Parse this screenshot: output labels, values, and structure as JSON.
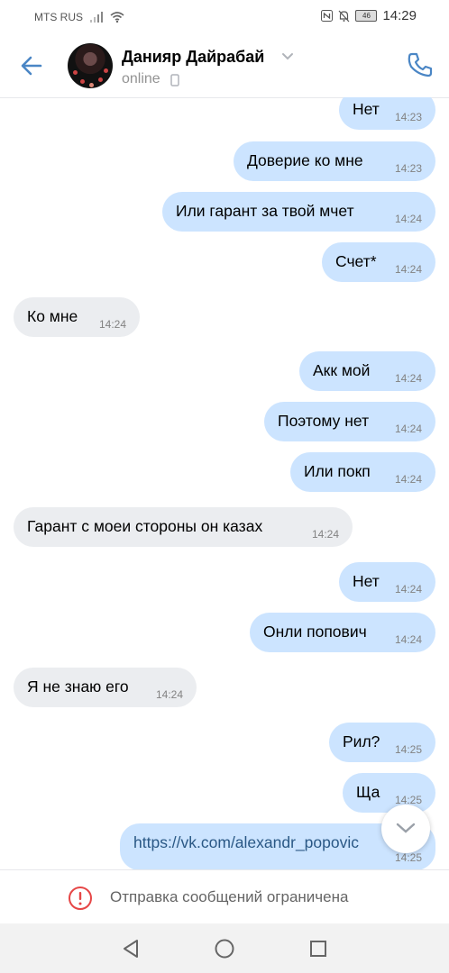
{
  "status_bar": {
    "carrier": "MTS RUS",
    "battery": "46",
    "time": "14:29"
  },
  "header": {
    "contact_name": "Данияр Дайрабай",
    "presence": "online",
    "icons": [
      "back-arrow-icon",
      "chevron-down-icon",
      "mobile-device-icon",
      "phone-icon"
    ]
  },
  "messages": [
    {
      "dir": "out",
      "text": "Нет",
      "time": "14:23"
    },
    {
      "dir": "out",
      "text": "Доверие ко мне",
      "time": "14:23"
    },
    {
      "dir": "out",
      "text": "Или гарант за твой мчет",
      "time": "14:24"
    },
    {
      "dir": "out",
      "text": "Счет*",
      "time": "14:24"
    },
    {
      "dir": "in",
      "text": "Ко мне",
      "time": "14:24"
    },
    {
      "dir": "out",
      "text": "Акк мой",
      "time": "14:24"
    },
    {
      "dir": "out",
      "text": "Поэтому нет",
      "time": "14:24"
    },
    {
      "dir": "out",
      "text": "Или покп",
      "time": "14:24"
    },
    {
      "dir": "in",
      "text": "Гарант с моеи стороны он казах",
      "time": "14:24"
    },
    {
      "dir": "out",
      "text": "Нет",
      "time": "14:24"
    },
    {
      "dir": "out",
      "text": "Онли попович",
      "time": "14:24"
    },
    {
      "dir": "in",
      "text": "Я не знаю его",
      "time": "14:24"
    },
    {
      "dir": "out",
      "text": "Рил?",
      "time": "14:25"
    },
    {
      "dir": "out",
      "text": "Ща",
      "time": "14:25"
    },
    {
      "dir": "out",
      "text": "https://vk.com/alexandr_popovic",
      "time": "14:25",
      "is_link": true
    }
  ],
  "restriction": {
    "text": "Отправка сообщений ограничена"
  },
  "colors": {
    "accent": "#4a86c5",
    "outgoing_bubble": "#cce4ff",
    "incoming_bubble": "#ebedf0",
    "warning": "#e64646"
  }
}
